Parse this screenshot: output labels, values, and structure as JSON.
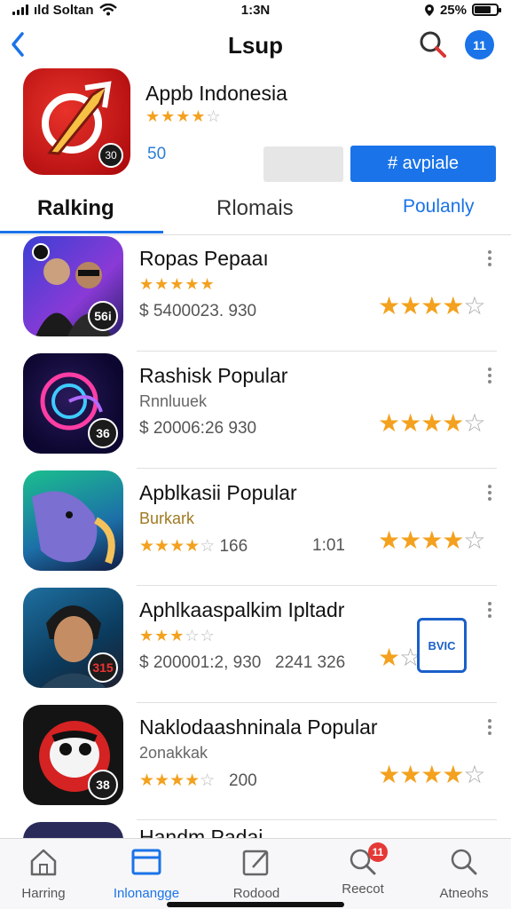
{
  "status_bar": {
    "carrier": "ıld Soltan",
    "time": "1:3N",
    "battery": "25%",
    "battery_level": 0.7
  },
  "nav": {
    "title": "Lsup",
    "avatar_text": "11"
  },
  "featured": {
    "name": "Appb Indonesia",
    "stars_filled": "★★★★",
    "stars_empty": "☆",
    "count": "50",
    "badge": "30",
    "button_label": "# avpiale"
  },
  "tabs": [
    {
      "label": "Ralking"
    },
    {
      "label": "Rlomais"
    },
    {
      "label": "Poulanly"
    }
  ],
  "apps": [
    {
      "name": "Ropas Pepaaı",
      "sub_stars": "★★★★★",
      "meta": "$ 5400023. 930",
      "extra": "",
      "num": "56i",
      "rating_filled": "★★★★",
      "rating_empty": "☆"
    },
    {
      "name": "Rashisk Popular",
      "sub": "Rnnluuek",
      "meta": "$ 20006:26 930",
      "extra": "",
      "num": "36",
      "rating_filled": "★★★★",
      "rating_empty": "☆"
    },
    {
      "name": "Apblkasii Popular",
      "sub": "Burkark",
      "meta_stars_filled": "★★★★",
      "meta_stars_empty": "☆",
      "meta": "166",
      "extra": "1:01",
      "num": "",
      "rating_filled": "★★★★",
      "rating_empty": "☆"
    },
    {
      "name": "Aphlkaaspalkim Ipltadr",
      "sub_stars_filled": "★★★",
      "sub_stars_empty": "☆☆",
      "meta": "$ 200001:2, 930",
      "extra": "2241 326",
      "num": "315",
      "rating_filled": "★",
      "rating_empty": "☆",
      "badge_art": "BVIC"
    },
    {
      "name": "Naklodaashninala Popular",
      "sub": "2onakkak",
      "meta_stars_filled": "★★★★",
      "meta_stars_empty": "☆",
      "meta": "200",
      "extra": "",
      "num": "38",
      "rating_filled": "★★★★",
      "rating_empty": "☆"
    },
    {
      "name": "Handm Padai"
    }
  ],
  "tabbar": [
    {
      "label": "Harring",
      "icon": "home-icon"
    },
    {
      "label": "Inlonangge",
      "icon": "window-icon"
    },
    {
      "label": "Rodood",
      "icon": "edit-icon"
    },
    {
      "label": "Reecot",
      "icon": "search-icon",
      "badge": "11"
    },
    {
      "label": "Atneohs",
      "icon": "search-icon"
    }
  ],
  "colors": {
    "accent": "#1a73e8",
    "star": "#f3a11e",
    "feature_red": "#d81e1e"
  }
}
